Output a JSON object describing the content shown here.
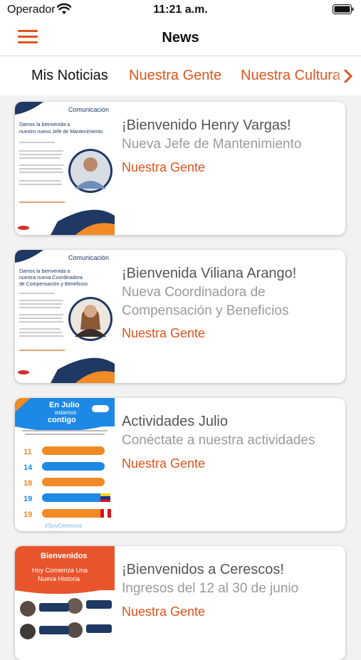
{
  "status_bar": {
    "carrier": "Operador",
    "time": "11:21 a.m."
  },
  "nav": {
    "title": "News"
  },
  "tabs": [
    {
      "label": "Mis Noticias"
    },
    {
      "label": "Nuestra Gente"
    },
    {
      "label": "Nuestra Cultura"
    }
  ],
  "articles": [
    {
      "title": "¡Bienvenido Henry Vargas!",
      "subtitle": "Nueva Jefe de Mantenimiento",
      "category": "Nuestra Gente",
      "thumb": {
        "brand": "Comunicación",
        "headline_1": "Damos la bienvenida a",
        "headline_2": "nuestro nuevo Jefe de Mantenimiento"
      }
    },
    {
      "title": "¡Bienvenida Viliana Arango!",
      "subtitle": "Nueva Coordinadora de Compensación y Beneficios",
      "category": "Nuestra Gente",
      "thumb": {
        "brand": "Comunicación",
        "headline_1": "Damos la bienvenida a",
        "headline_2": "nuestra nueva Coordinadora",
        "headline_3": "de Compensación y Beneficios"
      }
    },
    {
      "title": "Actividades Julio",
      "subtitle": "Conéctate a nuestra actividades",
      "category": "Nuestra Gente",
      "thumb": {
        "header_1": "En Julio",
        "header_2": "estamos",
        "header_3": "contigo",
        "days": [
          "11",
          "14",
          "18",
          "19",
          "19"
        ],
        "tag": "#SoyCerescos"
      }
    },
    {
      "title": "¡Bienvenidos a Cerescos!",
      "subtitle": "Ingresos del 12 al 30 de junio",
      "category": "Nuestra Gente",
      "thumb": {
        "header": "Bienvenidos",
        "line_1": "Hoy Comienza Una",
        "line_2": "Nueva Historia"
      }
    }
  ],
  "colors": {
    "accent": "#e0541c",
    "navy": "#1f3864",
    "orange": "#f08a24"
  }
}
